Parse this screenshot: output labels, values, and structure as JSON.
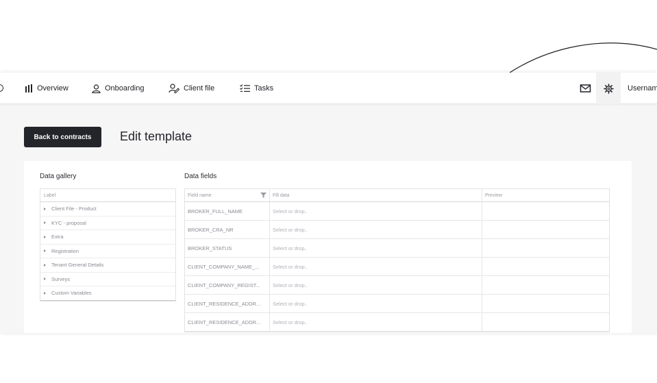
{
  "nav": {
    "items": [
      {
        "label": "Overview",
        "icon": "bar-chart-icon"
      },
      {
        "label": "Onboarding",
        "icon": "user-icon"
      },
      {
        "label": "Client file",
        "icon": "user-edit-icon"
      },
      {
        "label": "Tasks",
        "icon": "checklist-icon"
      }
    ],
    "username": "Usernam"
  },
  "page": {
    "back_label": "Back to contracts",
    "title": "Edit template"
  },
  "gallery": {
    "title": "Data gallery",
    "header": "Label",
    "items": [
      "Client File - Product",
      "KYC - proposal",
      "Extra",
      "Registration",
      "Tenant General Details",
      "Surveys",
      "Custom Variables"
    ]
  },
  "fields": {
    "title": "Data fields",
    "headers": [
      "Field name",
      "Fill data",
      "Preview"
    ],
    "rows": [
      {
        "name": "BROKER_FULL_NAME",
        "fill": "Select or drop..",
        "preview": ""
      },
      {
        "name": "BROKER_CRA_NR",
        "fill": "Select or drop..",
        "preview": ""
      },
      {
        "name": "BROKER_STATUS",
        "fill": "Select or drop..",
        "preview": ""
      },
      {
        "name": "CLIENT_COMPANY_NAME_...",
        "fill": "Select or drop..",
        "preview": ""
      },
      {
        "name": "CLIENT_COMPANY_REGIST...",
        "fill": "Select or drop..",
        "preview": ""
      },
      {
        "name": "CLIENT_RESIDENCE_ADDR...",
        "fill": "Select or drop..",
        "preview": ""
      },
      {
        "name": "CLIENT_RESIDENCE_ADDR...",
        "fill": "Select or drop..",
        "preview": ""
      }
    ]
  }
}
